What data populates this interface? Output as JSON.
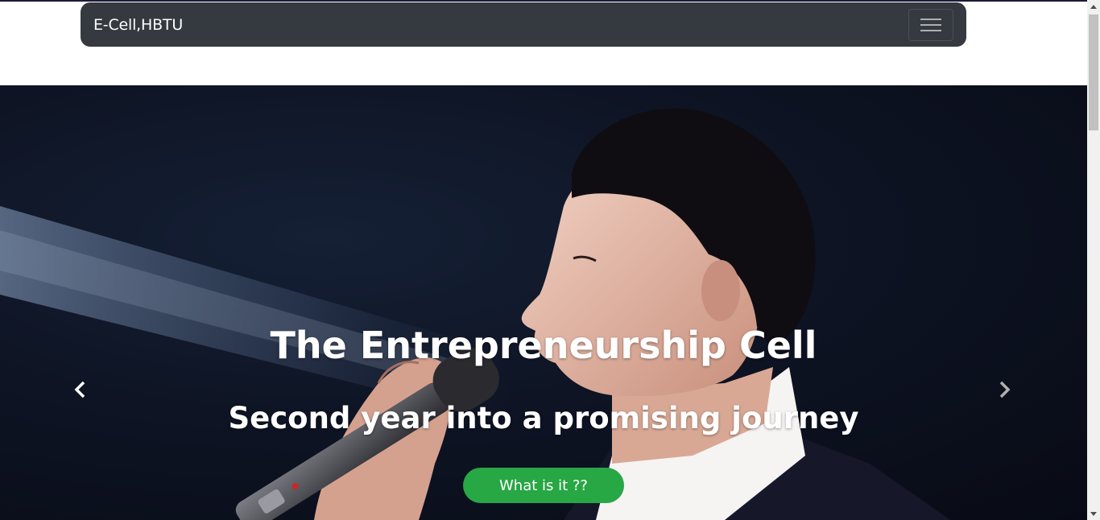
{
  "navbar": {
    "brand": "E-Cell,HBTU",
    "toggler_icon": "hamburger-menu-icon",
    "background": "#343a40"
  },
  "hero": {
    "title": "The Entrepreneurship Cell",
    "subtitle": "Second year into a promising journey",
    "cta_label": "What is it ??",
    "cta_color": "#28a745",
    "prev_icon": "chevron-left-icon",
    "next_icon": "chevron-right-icon"
  },
  "scrollbar": {
    "up_icon": "arrow-up-icon",
    "down_icon": "arrow-down-icon"
  }
}
